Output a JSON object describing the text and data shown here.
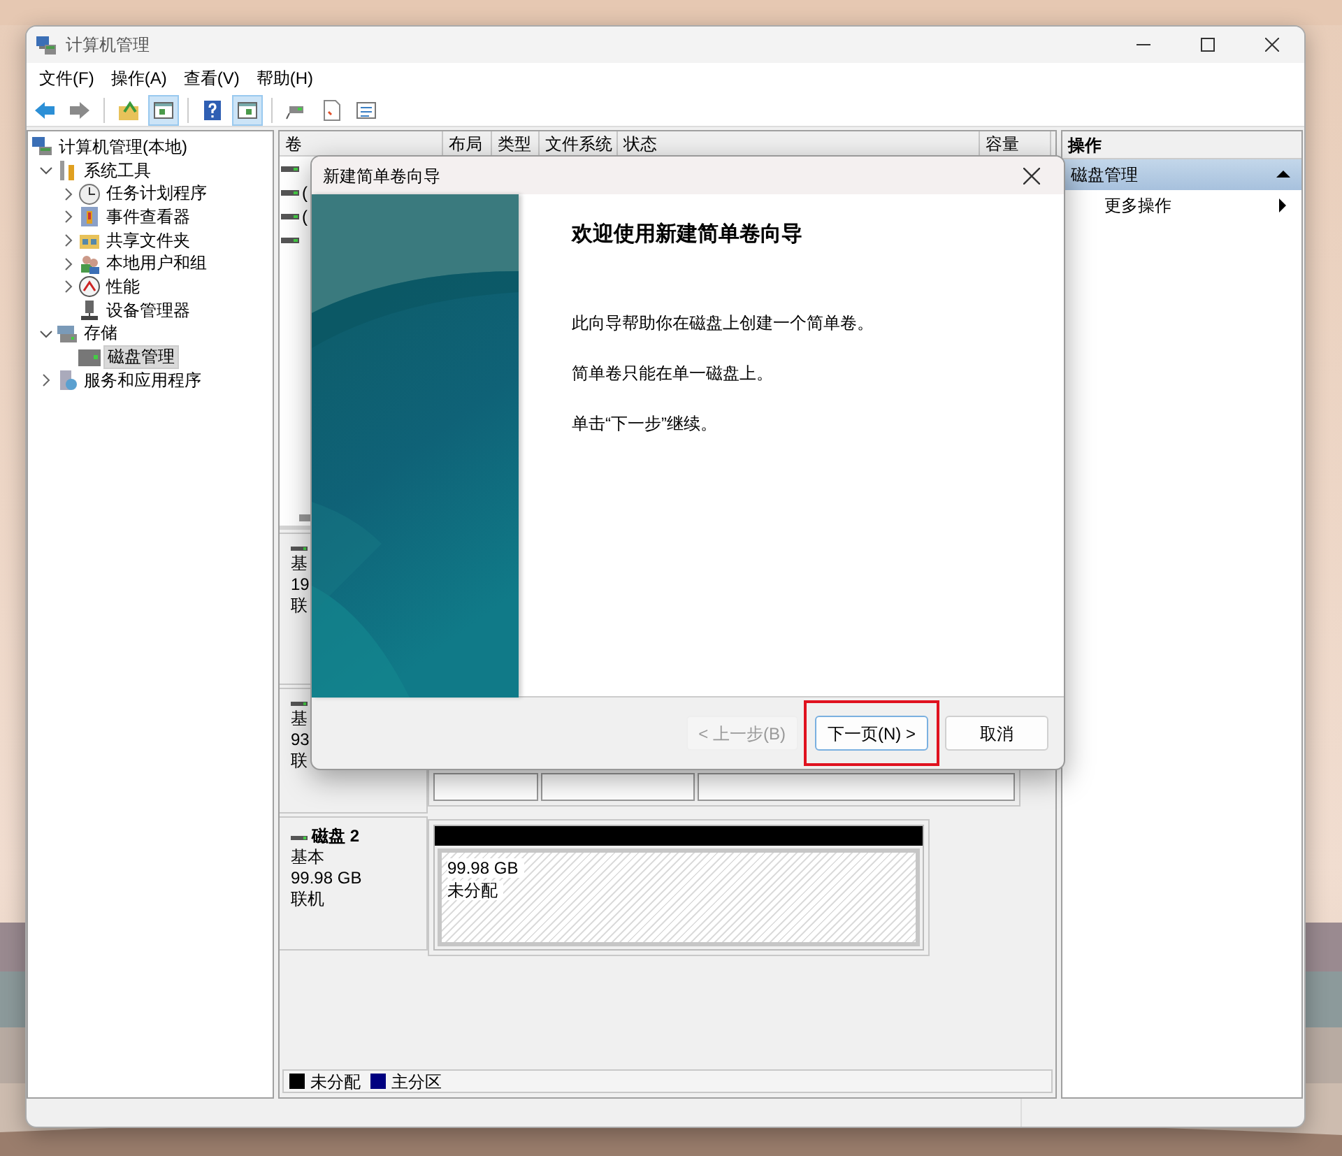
{
  "window": {
    "title": "计算机管理"
  },
  "menu": [
    "文件(F)",
    "操作(A)",
    "查看(V)",
    "帮助(H)"
  ],
  "toolbar": [
    {
      "kind": "back",
      "pressed": false
    },
    {
      "kind": "forward",
      "pressed": false
    },
    {
      "kind": "up",
      "pressed": false
    },
    {
      "kind": "tree",
      "pressed": true
    },
    {
      "kind": "help",
      "pressed": false
    },
    {
      "kind": "pane",
      "pressed": true
    },
    {
      "kind": "connect",
      "pressed": false
    },
    {
      "kind": "check",
      "pressed": false
    },
    {
      "kind": "list",
      "pressed": false
    }
  ],
  "tree": [
    {
      "label": "计算机管理(本地)",
      "kind": "computer",
      "selected": false,
      "children": [
        {
          "label": "系统工具",
          "kind": "tools",
          "expanded": true,
          "selected": false,
          "children": [
            {
              "label": "任务计划程序",
              "kind": "clock",
              "expanded": false,
              "selected": false
            },
            {
              "label": "事件查看器",
              "kind": "events",
              "expanded": false,
              "selected": false
            },
            {
              "label": "共享文件夹",
              "kind": "share",
              "expanded": false,
              "selected": false
            },
            {
              "label": "本地用户和组",
              "kind": "users",
              "expanded": false,
              "selected": false
            },
            {
              "label": "性能",
              "kind": "perf",
              "expanded": false,
              "selected": false
            },
            {
              "label": "设备管理器",
              "kind": "device",
              "selected": false
            }
          ]
        },
        {
          "label": "存储",
          "kind": "storage",
          "expanded": true,
          "selected": false,
          "children": [
            {
              "label": "磁盘管理",
              "kind": "disk",
              "selected": true
            }
          ]
        },
        {
          "label": "服务和应用程序",
          "kind": "services",
          "expanded": false,
          "selected": false
        }
      ]
    }
  ],
  "volumes": {
    "columns": [
      "卷",
      "布局",
      "类型",
      "文件系统",
      "状态",
      "容量"
    ],
    "rows": [
      {
        "kind": "volume"
      },
      {
        "kind": "volume",
        "text": "("
      },
      {
        "kind": "volume",
        "text": "("
      },
      {
        "kind": "volume"
      }
    ]
  },
  "disks": [
    {
      "lines": [
        "基",
        "19",
        "联"
      ]
    },
    {
      "lines": [
        "基",
        "93",
        "联"
      ],
      "partitions": [
        {
          "kind": "primary"
        },
        {
          "kind": "primary"
        },
        {
          "kind": "primary"
        }
      ]
    },
    {
      "name": "磁盘 2",
      "lines": [
        "基本",
        "99.98 GB",
        "联机"
      ],
      "partitions": [
        {
          "kind": "unallocated",
          "size": "99.98 GB",
          "status": "未分配"
        }
      ]
    }
  ],
  "legend": [
    {
      "label": "未分配",
      "color": "#000000"
    },
    {
      "label": "主分区",
      "color": "#000080"
    }
  ],
  "actions": {
    "title": "操作",
    "items": [
      {
        "kind": "section",
        "label": "磁盘管理",
        "expanded": true
      },
      {
        "kind": "submenu",
        "label": "更多操作"
      }
    ]
  },
  "dialog": {
    "title": "新建简单卷向导",
    "heading": "欢迎使用新建简单卷向导",
    "paragraphs": [
      "此向导帮助你在磁盘上创建一个简单卷。",
      "简单卷只能在单一磁盘上。",
      "单击“下一步”继续。"
    ],
    "buttons": [
      {
        "label": "< 上一步(B)",
        "disabled": true,
        "default": false,
        "highlighted": false
      },
      {
        "label": "下一页(N) >",
        "disabled": false,
        "default": true,
        "highlighted": true
      },
      {
        "label": "取消",
        "disabled": false,
        "default": false,
        "highlighted": false
      }
    ]
  }
}
